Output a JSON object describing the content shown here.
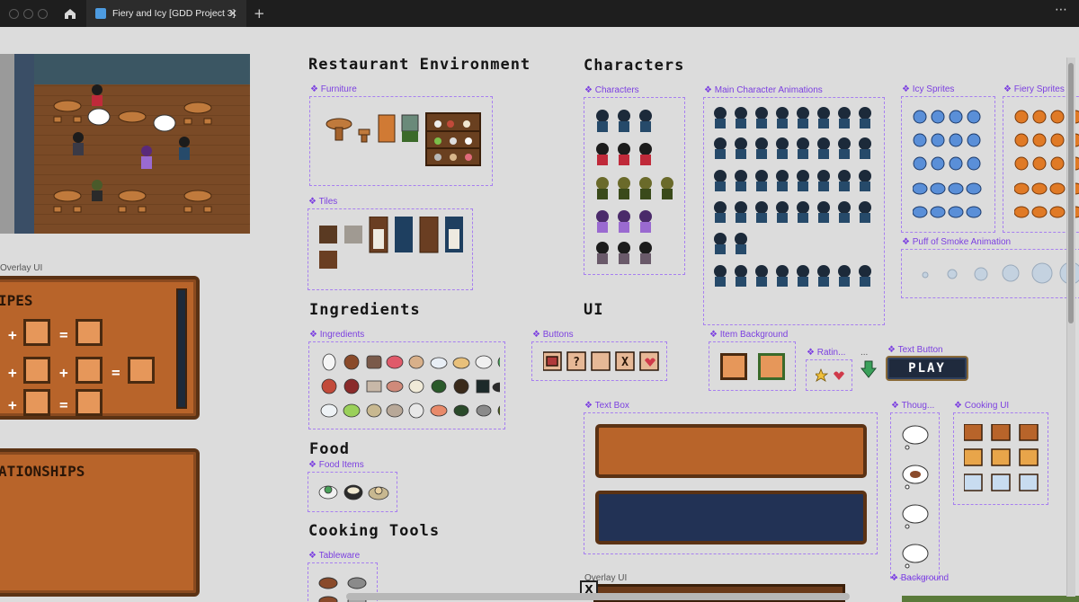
{
  "window": {
    "tab_title": "Fiery and Icy [GDD Project 3]",
    "tab_close": "✕",
    "new_tab": "+",
    "more": "⋯"
  },
  "headings": {
    "restaurant_environment": "Restaurant Environment",
    "characters": "Characters",
    "ingredients": "Ingredients",
    "ui": "UI",
    "food": "Food",
    "cooking_tools": "Cooking Tools"
  },
  "frames": {
    "furniture": "❖ Furniture",
    "tiles": "❖ Tiles",
    "characters": "❖ Characters",
    "main_character_animations": "❖ Main Character Animations",
    "icy_sprites": "❖ Icy Sprites",
    "fiery_sprites": "❖ Fiery Sprites",
    "puff_of_smoke_animation": "❖ Puff of Smoke Animation",
    "ingredients": "❖ Ingredients",
    "buttons": "❖ Buttons",
    "item_background": "❖ Item Background",
    "rating": "❖ Ratin...",
    "ellipsis": "...",
    "text_button": "❖ Text Button",
    "text_box": "❖ Text Box",
    "thought": "❖ Thoug...",
    "cooking_ui": "❖ Cooking UI",
    "food_items": "❖ Food Items",
    "tableware": "❖ Tableware",
    "background": "❖ Background",
    "overlay_ui_left": "Overlay UI",
    "overlay_ui_bottom": "Overlay UI"
  },
  "panels": {
    "recipes_title": "IPES",
    "relationships_title": "ATIONSHIPS",
    "plus": "+",
    "equals": "="
  },
  "ui_elements": {
    "play_label": "PLAY",
    "close_label": "X",
    "button_question": "?",
    "button_x": "X"
  },
  "colors": {
    "accent_purple": "#7b3fe0",
    "wood_brown": "#b8642a",
    "navy": "#223255",
    "icy_blue": "#5a8fd8",
    "fiery_orange": "#e07a26"
  }
}
